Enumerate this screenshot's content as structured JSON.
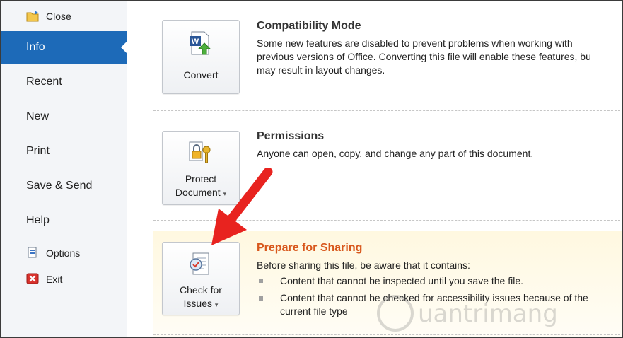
{
  "sidebar": {
    "close": "Close",
    "items": [
      {
        "label": "Info"
      },
      {
        "label": "Recent"
      },
      {
        "label": "New"
      },
      {
        "label": "Print"
      },
      {
        "label": "Save & Send"
      },
      {
        "label": "Help"
      }
    ],
    "options": "Options",
    "exit": "Exit"
  },
  "sections": {
    "compat": {
      "button": "Convert",
      "title": "Compatibility Mode",
      "line1": "Some new features are disabled to prevent problems when working with",
      "line2": "previous versions of Office. Converting this file will enable these features, bu",
      "line3": "may result in layout changes."
    },
    "perm": {
      "button_line1": "Protect",
      "button_line2": "Document",
      "title": "Permissions",
      "desc": "Anyone can open, copy, and change any part of this document."
    },
    "prepare": {
      "button_line1": "Check for",
      "button_line2": "Issues",
      "title": "Prepare for Sharing",
      "desc": "Before sharing this file, be aware that it contains:",
      "bullet1": "Content that cannot be inspected until you save the file.",
      "bullet2_l1": "Content that cannot be checked for accessibility issues because of the",
      "bullet2_l2": "current file type"
    }
  },
  "colors": {
    "active": "#1d6ab8",
    "prepare_title": "#d8571c",
    "arrow": "#e8231f"
  },
  "watermark_text": "uantrimang"
}
